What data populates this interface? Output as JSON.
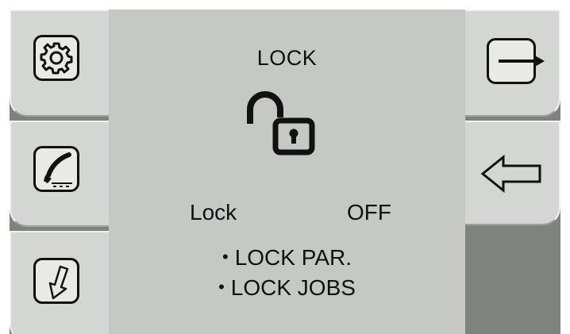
{
  "screen": {
    "title": "LOCK",
    "lock_status": {
      "label": "Lock",
      "value": "OFF"
    },
    "options": [
      "LOCK PAR.",
      "LOCK JOBS"
    ],
    "bullet": "•"
  },
  "left_menu": [
    {
      "icon": "gear-icon"
    },
    {
      "icon": "welding-torch-icon"
    },
    {
      "icon": "down-arrow-icon"
    }
  ],
  "right_menu": [
    {
      "icon": "exit-arrow-icon"
    },
    {
      "icon": "back-arrow-icon"
    }
  ],
  "colors": {
    "frame": "#7e837e",
    "tab": "#d4d6d3",
    "center": "#c5c8c3",
    "ink": "#111111"
  }
}
